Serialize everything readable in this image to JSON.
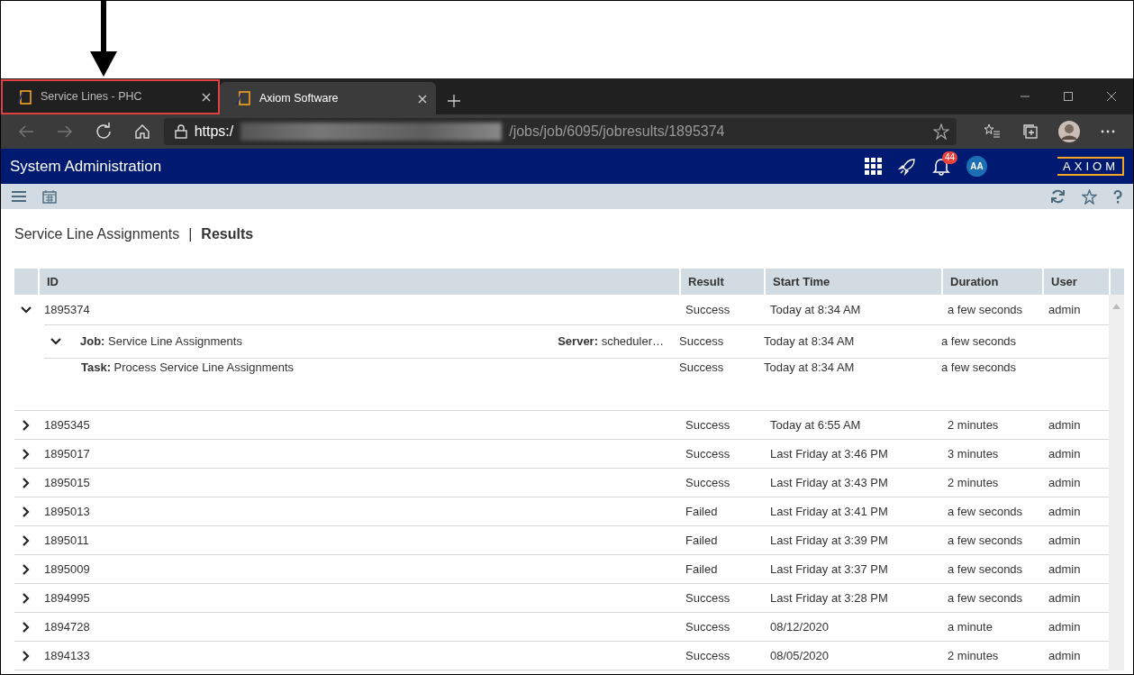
{
  "browser": {
    "tabs": [
      {
        "title": "Service Lines - PHC",
        "selected": false,
        "annotated": true
      },
      {
        "title": "Axiom Software",
        "selected": true,
        "annotated": false
      }
    ],
    "address": {
      "scheme": "https:/",
      "path": "/jobs/job/6095/jobresults/1895374"
    }
  },
  "app": {
    "title": "System Administration",
    "notification_count": "44",
    "avatar": "AA",
    "logo": "AXIOM"
  },
  "breadcrumb": {
    "parent": "Service Line Assignments",
    "separator": "|",
    "current": "Results"
  },
  "table": {
    "columns": [
      "ID",
      "Result",
      "Start Time",
      "Duration",
      "User"
    ],
    "rows": [
      {
        "id": "1895374",
        "result": "Success",
        "start": "Today at 8:34 AM",
        "duration": "a few seconds",
        "user": "admin",
        "expanded": true,
        "children": [
          {
            "kind": "job",
            "label": "Job:",
            "name": "Service Line Assignments",
            "server_label": "Server:",
            "server": "scheduler…",
            "result": "Success",
            "start": "Today at 8:34 AM",
            "duration": "a few seconds",
            "expanded": true,
            "children": [
              {
                "kind": "task",
                "label": "Task:",
                "name": "Process Service Line Assignments",
                "result": "Success",
                "start": "Today at 8:34 AM",
                "duration": "a few seconds"
              }
            ]
          }
        ]
      },
      {
        "id": "1895345",
        "result": "Success",
        "start": "Today at 6:55 AM",
        "duration": "2 minutes",
        "user": "admin",
        "expanded": false
      },
      {
        "id": "1895017",
        "result": "Success",
        "start": "Last Friday at 3:46 PM",
        "duration": "3 minutes",
        "user": "admin",
        "expanded": false
      },
      {
        "id": "1895015",
        "result": "Success",
        "start": "Last Friday at 3:43 PM",
        "duration": "2 minutes",
        "user": "admin",
        "expanded": false
      },
      {
        "id": "1895013",
        "result": "Failed",
        "start": "Last Friday at 3:41 PM",
        "duration": "a few seconds",
        "user": "admin",
        "expanded": false
      },
      {
        "id": "1895011",
        "result": "Failed",
        "start": "Last Friday at 3:39 PM",
        "duration": "a few seconds",
        "user": "admin",
        "expanded": false
      },
      {
        "id": "1895009",
        "result": "Failed",
        "start": "Last Friday at 3:37 PM",
        "duration": "a few seconds",
        "user": "admin",
        "expanded": false
      },
      {
        "id": "1894995",
        "result": "Success",
        "start": "Last Friday at 3:28 PM",
        "duration": "a few seconds",
        "user": "admin",
        "expanded": false
      },
      {
        "id": "1894728",
        "result": "Success",
        "start": "08/12/2020",
        "duration": "a minute",
        "user": "admin",
        "expanded": false
      },
      {
        "id": "1894133",
        "result": "Success",
        "start": "08/05/2020",
        "duration": "2 minutes",
        "user": "admin",
        "expanded": false
      }
    ]
  }
}
